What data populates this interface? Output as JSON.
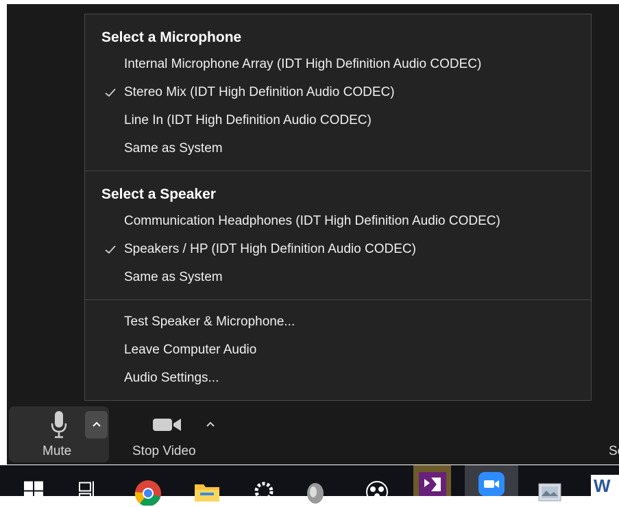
{
  "menu": {
    "microphone_heading": "Select a Microphone",
    "microphones": [
      {
        "label": "Internal Microphone Array (IDT High Definition Audio CODEC)",
        "checked": false
      },
      {
        "label": "Stereo Mix (IDT High Definition Audio CODEC)",
        "checked": true
      },
      {
        "label": "Line In (IDT High Definition Audio CODEC)",
        "checked": false
      },
      {
        "label": "Same as System",
        "checked": false
      }
    ],
    "speaker_heading": "Select a Speaker",
    "speakers": [
      {
        "label": "Communication Headphones (IDT High Definition Audio CODEC)",
        "checked": false
      },
      {
        "label": "Speakers / HP (IDT High Definition Audio CODEC)",
        "checked": true
      },
      {
        "label": "Same as System",
        "checked": false
      }
    ],
    "actions": [
      {
        "label": "Test Speaker & Microphone..."
      },
      {
        "label": "Leave Computer Audio"
      },
      {
        "label": "Audio Settings..."
      }
    ]
  },
  "toolbar": {
    "mute_label": "Mute",
    "stop_video_label": "Stop Video",
    "partial_label": "Se"
  },
  "taskbar": {
    "icons": [
      "windows-start-icon",
      "task-view-icon",
      "chrome-icon",
      "file-explorer-icon",
      "settings-gear-icon",
      "speaker-app-icon",
      "obs-icon",
      "visual-studio-icon",
      "zoom-icon",
      "photos-icon",
      "word-icon"
    ],
    "word_letter": "W"
  },
  "colors": {
    "menu_bg": "#232323",
    "app_bg": "#1a1a1a",
    "zoom_blue": "#2d8cff",
    "vs_purple": "#68217a"
  }
}
